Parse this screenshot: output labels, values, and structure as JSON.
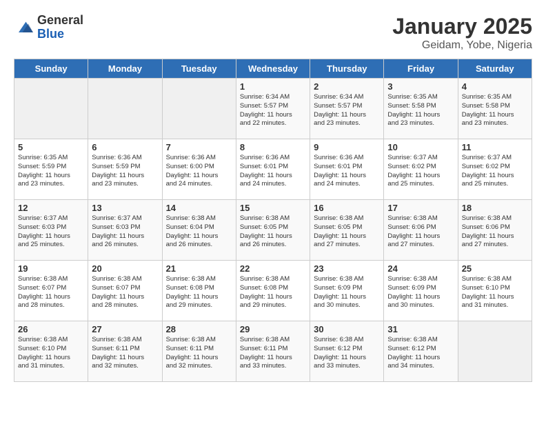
{
  "logo": {
    "general": "General",
    "blue": "Blue"
  },
  "title": "January 2025",
  "subtitle": "Geidam, Yobe, Nigeria",
  "days_of_week": [
    "Sunday",
    "Monday",
    "Tuesday",
    "Wednesday",
    "Thursday",
    "Friday",
    "Saturday"
  ],
  "weeks": [
    [
      {
        "day": "",
        "info": ""
      },
      {
        "day": "",
        "info": ""
      },
      {
        "day": "",
        "info": ""
      },
      {
        "day": "1",
        "info": "Sunrise: 6:34 AM\nSunset: 5:57 PM\nDaylight: 11 hours\nand 22 minutes."
      },
      {
        "day": "2",
        "info": "Sunrise: 6:34 AM\nSunset: 5:57 PM\nDaylight: 11 hours\nand 23 minutes."
      },
      {
        "day": "3",
        "info": "Sunrise: 6:35 AM\nSunset: 5:58 PM\nDaylight: 11 hours\nand 23 minutes."
      },
      {
        "day": "4",
        "info": "Sunrise: 6:35 AM\nSunset: 5:58 PM\nDaylight: 11 hours\nand 23 minutes."
      }
    ],
    [
      {
        "day": "5",
        "info": "Sunrise: 6:35 AM\nSunset: 5:59 PM\nDaylight: 11 hours\nand 23 minutes."
      },
      {
        "day": "6",
        "info": "Sunrise: 6:36 AM\nSunset: 5:59 PM\nDaylight: 11 hours\nand 23 minutes."
      },
      {
        "day": "7",
        "info": "Sunrise: 6:36 AM\nSunset: 6:00 PM\nDaylight: 11 hours\nand 24 minutes."
      },
      {
        "day": "8",
        "info": "Sunrise: 6:36 AM\nSunset: 6:01 PM\nDaylight: 11 hours\nand 24 minutes."
      },
      {
        "day": "9",
        "info": "Sunrise: 6:36 AM\nSunset: 6:01 PM\nDaylight: 11 hours\nand 24 minutes."
      },
      {
        "day": "10",
        "info": "Sunrise: 6:37 AM\nSunset: 6:02 PM\nDaylight: 11 hours\nand 25 minutes."
      },
      {
        "day": "11",
        "info": "Sunrise: 6:37 AM\nSunset: 6:02 PM\nDaylight: 11 hours\nand 25 minutes."
      }
    ],
    [
      {
        "day": "12",
        "info": "Sunrise: 6:37 AM\nSunset: 6:03 PM\nDaylight: 11 hours\nand 25 minutes."
      },
      {
        "day": "13",
        "info": "Sunrise: 6:37 AM\nSunset: 6:03 PM\nDaylight: 11 hours\nand 26 minutes."
      },
      {
        "day": "14",
        "info": "Sunrise: 6:38 AM\nSunset: 6:04 PM\nDaylight: 11 hours\nand 26 minutes."
      },
      {
        "day": "15",
        "info": "Sunrise: 6:38 AM\nSunset: 6:05 PM\nDaylight: 11 hours\nand 26 minutes."
      },
      {
        "day": "16",
        "info": "Sunrise: 6:38 AM\nSunset: 6:05 PM\nDaylight: 11 hours\nand 27 minutes."
      },
      {
        "day": "17",
        "info": "Sunrise: 6:38 AM\nSunset: 6:06 PM\nDaylight: 11 hours\nand 27 minutes."
      },
      {
        "day": "18",
        "info": "Sunrise: 6:38 AM\nSunset: 6:06 PM\nDaylight: 11 hours\nand 27 minutes."
      }
    ],
    [
      {
        "day": "19",
        "info": "Sunrise: 6:38 AM\nSunset: 6:07 PM\nDaylight: 11 hours\nand 28 minutes."
      },
      {
        "day": "20",
        "info": "Sunrise: 6:38 AM\nSunset: 6:07 PM\nDaylight: 11 hours\nand 28 minutes."
      },
      {
        "day": "21",
        "info": "Sunrise: 6:38 AM\nSunset: 6:08 PM\nDaylight: 11 hours\nand 29 minutes."
      },
      {
        "day": "22",
        "info": "Sunrise: 6:38 AM\nSunset: 6:08 PM\nDaylight: 11 hours\nand 29 minutes."
      },
      {
        "day": "23",
        "info": "Sunrise: 6:38 AM\nSunset: 6:09 PM\nDaylight: 11 hours\nand 30 minutes."
      },
      {
        "day": "24",
        "info": "Sunrise: 6:38 AM\nSunset: 6:09 PM\nDaylight: 11 hours\nand 30 minutes."
      },
      {
        "day": "25",
        "info": "Sunrise: 6:38 AM\nSunset: 6:10 PM\nDaylight: 11 hours\nand 31 minutes."
      }
    ],
    [
      {
        "day": "26",
        "info": "Sunrise: 6:38 AM\nSunset: 6:10 PM\nDaylight: 11 hours\nand 31 minutes."
      },
      {
        "day": "27",
        "info": "Sunrise: 6:38 AM\nSunset: 6:11 PM\nDaylight: 11 hours\nand 32 minutes."
      },
      {
        "day": "28",
        "info": "Sunrise: 6:38 AM\nSunset: 6:11 PM\nDaylight: 11 hours\nand 32 minutes."
      },
      {
        "day": "29",
        "info": "Sunrise: 6:38 AM\nSunset: 6:11 PM\nDaylight: 11 hours\nand 33 minutes."
      },
      {
        "day": "30",
        "info": "Sunrise: 6:38 AM\nSunset: 6:12 PM\nDaylight: 11 hours\nand 33 minutes."
      },
      {
        "day": "31",
        "info": "Sunrise: 6:38 AM\nSunset: 6:12 PM\nDaylight: 11 hours\nand 34 minutes."
      },
      {
        "day": "",
        "info": ""
      }
    ]
  ]
}
